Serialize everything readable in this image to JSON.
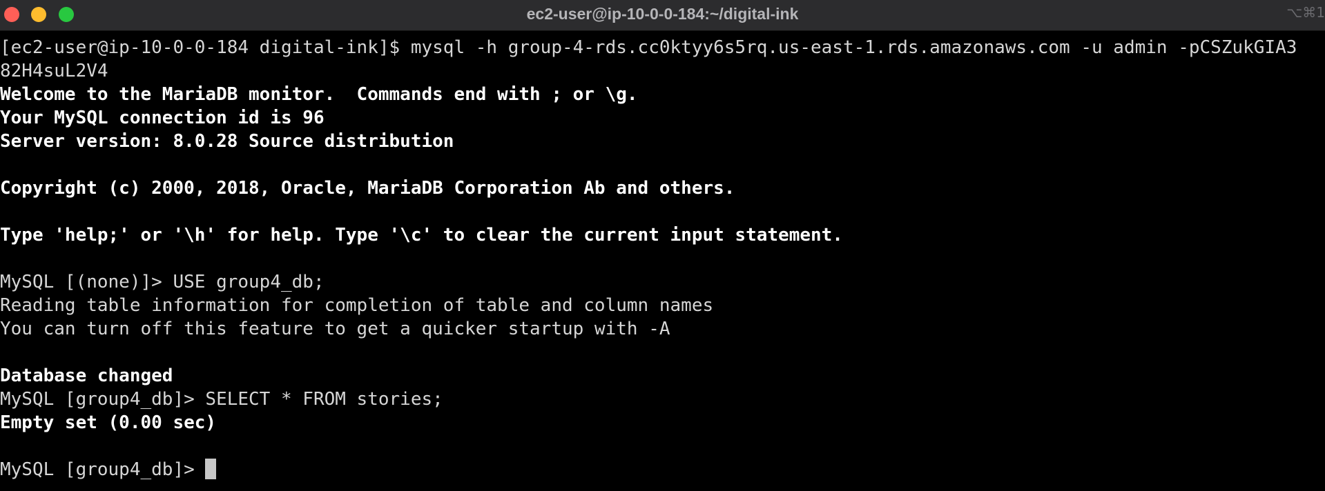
{
  "window": {
    "title": "ec2-user@ip-10-0-0-184:~/digital-ink",
    "shortcut": "⌥⌘1"
  },
  "terminal": {
    "lines": [
      {
        "text": "[ec2-user@ip-10-0-0-184 digital-ink]$ mysql -h group-4-rds.cc0ktyy6s5rq.us-east-1.rds.amazonaws.com -u admin -pCSZukGIA3",
        "bold": false
      },
      {
        "text": "82H4suL2V4",
        "bold": false
      },
      {
        "text": "Welcome to the MariaDB monitor.  Commands end with ; or \\g.",
        "bold": true
      },
      {
        "text": "Your MySQL connection id is 96",
        "bold": true
      },
      {
        "text": "Server version: 8.0.28 Source distribution",
        "bold": true
      },
      {
        "text": "",
        "bold": false
      },
      {
        "text": "Copyright (c) 2000, 2018, Oracle, MariaDB Corporation Ab and others.",
        "bold": true
      },
      {
        "text": "",
        "bold": false
      },
      {
        "text": "Type 'help;' or '\\h' for help. Type '\\c' to clear the current input statement.",
        "bold": true
      },
      {
        "text": "",
        "bold": false
      },
      {
        "text": "MySQL [(none)]> USE group4_db;",
        "bold": false
      },
      {
        "text": "Reading table information for completion of table and column names",
        "bold": false
      },
      {
        "text": "You can turn off this feature to get a quicker startup with -A",
        "bold": false
      },
      {
        "text": "",
        "bold": false
      },
      {
        "text": "Database changed",
        "bold": true
      },
      {
        "text": "MySQL [group4_db]> SELECT * FROM stories;",
        "bold": false
      },
      {
        "text": "Empty set (0.00 sec)",
        "bold": true
      },
      {
        "text": "",
        "bold": false
      }
    ],
    "prompt": "MySQL [group4_db]> "
  },
  "colors": {
    "background": "#000000",
    "titlebar": "#2c2c2e",
    "close": "#ff5f57",
    "minimize": "#febc2e",
    "maximize": "#28c840"
  },
  "icons": [
    "close-icon",
    "minimize-icon",
    "maximize-icon"
  ]
}
